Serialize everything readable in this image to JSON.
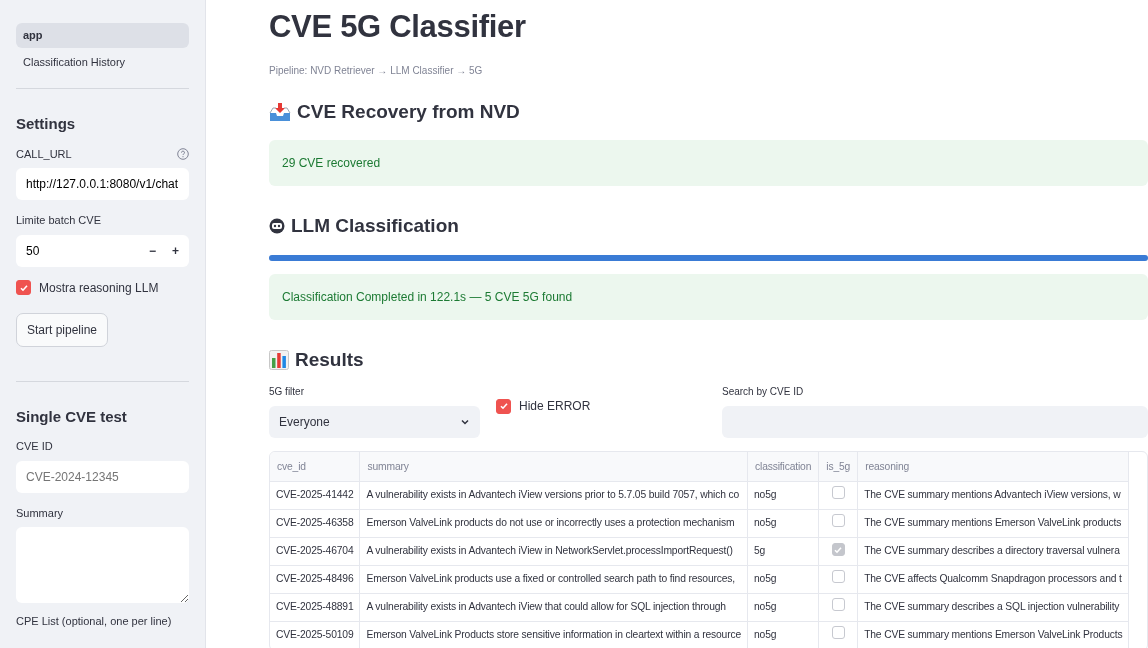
{
  "sidebar": {
    "nav": [
      {
        "label": "app",
        "selected": true
      },
      {
        "label": "Classification History",
        "selected": false
      }
    ],
    "settings": {
      "title": "Settings",
      "call_url": {
        "label": "CALL_URL",
        "value": "http://127.0.0.1:8080/v1/chat"
      },
      "batch_limit": {
        "label": "Limite batch CVE",
        "value": "50",
        "minus": "−",
        "plus": "+"
      },
      "show_reasoning": {
        "label": "Mostra reasoning LLM",
        "checked": true
      },
      "start_button": "Start pipeline"
    },
    "single_test": {
      "title": "Single CVE test",
      "cve_id": {
        "label": "CVE ID",
        "placeholder": "CVE-2024-12345"
      },
      "summary": {
        "label": "Summary"
      },
      "cpe_label": "CPE List (optional, one per line)"
    }
  },
  "main": {
    "title": "CVE 5G Classifier",
    "caption": "Pipeline: NVD Retriever → LLM Classifier → 5G",
    "recovery": {
      "title": "CVE Recovery from NVD",
      "message": "29 CVE recovered"
    },
    "classification": {
      "title": "LLM Classification",
      "level": 1,
      "message": "Classification Completed in 122.1s — 5 CVE 5G found"
    },
    "results": {
      "title": "Results",
      "filter": {
        "label": "5G filter",
        "value": "Everyone"
      },
      "hide_error": {
        "label": "Hide ERROR",
        "checked": true
      },
      "search": {
        "label": "Search by CVE ID"
      },
      "table": {
        "columns": [
          "cve_id",
          "summary",
          "classification",
          "is_5g",
          "reasoning"
        ],
        "rows": [
          {
            "cve_id": "CVE-2025-41442",
            "summary": "A vulnerability exists in Advantech iView versions prior to 5.7.05 build  7057, which co",
            "classification": "no5g",
            "is_5g": false,
            "reasoning": "The CVE summary mentions Advantech iView versions, w"
          },
          {
            "cve_id": "CVE-2025-46358",
            "summary": "Emerson ValveLink products  do not use or incorrectly uses a protection mechanism",
            "classification": "no5g",
            "is_5g": false,
            "reasoning": "The CVE summary mentions Emerson ValveLink products"
          },
          {
            "cve_id": "CVE-2025-46704",
            "summary": "A vulnerability exists in Advantech iView in  NetworkServlet.processImportRequest()",
            "classification": "5g",
            "is_5g": true,
            "reasoning": "The CVE summary describes a directory traversal vulnera"
          },
          {
            "cve_id": "CVE-2025-48496",
            "summary": "Emerson ValveLink products  use a fixed or controlled search path to find resources,",
            "classification": "no5g",
            "is_5g": false,
            "reasoning": "The CVE affects Qualcomm Snapdragon processors and t"
          },
          {
            "cve_id": "CVE-2025-48891",
            "summary": "A vulnerability exists in Advantech iView that could allow for SQL  injection through",
            "classification": "no5g",
            "is_5g": false,
            "reasoning": "The CVE summary describes a SQL injection vulnerability"
          },
          {
            "cve_id": "CVE-2025-50109",
            "summary": "Emerson ValveLink Products store sensitive information in cleartext within a resource",
            "classification": "no5g",
            "is_5g": false,
            "reasoning": "The CVE summary mentions Emerson ValveLink Products"
          }
        ]
      }
    }
  }
}
